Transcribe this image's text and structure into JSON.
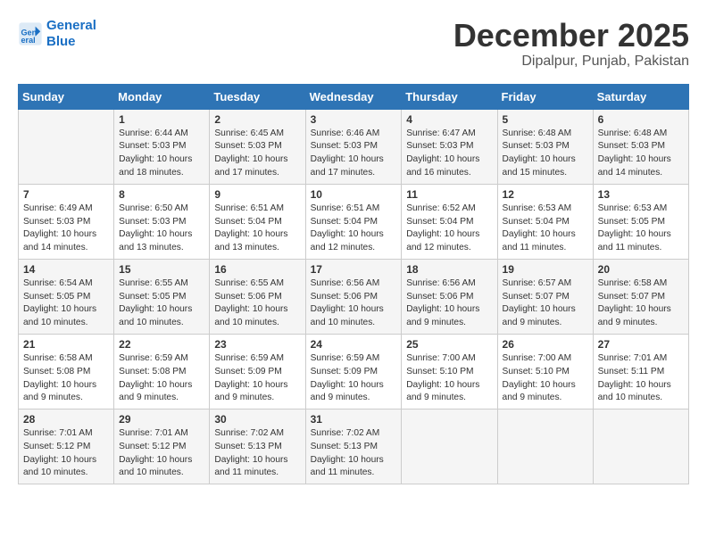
{
  "header": {
    "logo_line1": "General",
    "logo_line2": "Blue",
    "month": "December 2025",
    "location": "Dipalpur, Punjab, Pakistan"
  },
  "weekdays": [
    "Sunday",
    "Monday",
    "Tuesday",
    "Wednesday",
    "Thursday",
    "Friday",
    "Saturday"
  ],
  "weeks": [
    [
      {
        "day": "",
        "info": ""
      },
      {
        "day": "1",
        "info": "Sunrise: 6:44 AM\nSunset: 5:03 PM\nDaylight: 10 hours\nand 18 minutes."
      },
      {
        "day": "2",
        "info": "Sunrise: 6:45 AM\nSunset: 5:03 PM\nDaylight: 10 hours\nand 17 minutes."
      },
      {
        "day": "3",
        "info": "Sunrise: 6:46 AM\nSunset: 5:03 PM\nDaylight: 10 hours\nand 17 minutes."
      },
      {
        "day": "4",
        "info": "Sunrise: 6:47 AM\nSunset: 5:03 PM\nDaylight: 10 hours\nand 16 minutes."
      },
      {
        "day": "5",
        "info": "Sunrise: 6:48 AM\nSunset: 5:03 PM\nDaylight: 10 hours\nand 15 minutes."
      },
      {
        "day": "6",
        "info": "Sunrise: 6:48 AM\nSunset: 5:03 PM\nDaylight: 10 hours\nand 14 minutes."
      }
    ],
    [
      {
        "day": "7",
        "info": "Sunrise: 6:49 AM\nSunset: 5:03 PM\nDaylight: 10 hours\nand 14 minutes."
      },
      {
        "day": "8",
        "info": "Sunrise: 6:50 AM\nSunset: 5:03 PM\nDaylight: 10 hours\nand 13 minutes."
      },
      {
        "day": "9",
        "info": "Sunrise: 6:51 AM\nSunset: 5:04 PM\nDaylight: 10 hours\nand 13 minutes."
      },
      {
        "day": "10",
        "info": "Sunrise: 6:51 AM\nSunset: 5:04 PM\nDaylight: 10 hours\nand 12 minutes."
      },
      {
        "day": "11",
        "info": "Sunrise: 6:52 AM\nSunset: 5:04 PM\nDaylight: 10 hours\nand 12 minutes."
      },
      {
        "day": "12",
        "info": "Sunrise: 6:53 AM\nSunset: 5:04 PM\nDaylight: 10 hours\nand 11 minutes."
      },
      {
        "day": "13",
        "info": "Sunrise: 6:53 AM\nSunset: 5:05 PM\nDaylight: 10 hours\nand 11 minutes."
      }
    ],
    [
      {
        "day": "14",
        "info": "Sunrise: 6:54 AM\nSunset: 5:05 PM\nDaylight: 10 hours\nand 10 minutes."
      },
      {
        "day": "15",
        "info": "Sunrise: 6:55 AM\nSunset: 5:05 PM\nDaylight: 10 hours\nand 10 minutes."
      },
      {
        "day": "16",
        "info": "Sunrise: 6:55 AM\nSunset: 5:06 PM\nDaylight: 10 hours\nand 10 minutes."
      },
      {
        "day": "17",
        "info": "Sunrise: 6:56 AM\nSunset: 5:06 PM\nDaylight: 10 hours\nand 10 minutes."
      },
      {
        "day": "18",
        "info": "Sunrise: 6:56 AM\nSunset: 5:06 PM\nDaylight: 10 hours\nand 9 minutes."
      },
      {
        "day": "19",
        "info": "Sunrise: 6:57 AM\nSunset: 5:07 PM\nDaylight: 10 hours\nand 9 minutes."
      },
      {
        "day": "20",
        "info": "Sunrise: 6:58 AM\nSunset: 5:07 PM\nDaylight: 10 hours\nand 9 minutes."
      }
    ],
    [
      {
        "day": "21",
        "info": "Sunrise: 6:58 AM\nSunset: 5:08 PM\nDaylight: 10 hours\nand 9 minutes."
      },
      {
        "day": "22",
        "info": "Sunrise: 6:59 AM\nSunset: 5:08 PM\nDaylight: 10 hours\nand 9 minutes."
      },
      {
        "day": "23",
        "info": "Sunrise: 6:59 AM\nSunset: 5:09 PM\nDaylight: 10 hours\nand 9 minutes."
      },
      {
        "day": "24",
        "info": "Sunrise: 6:59 AM\nSunset: 5:09 PM\nDaylight: 10 hours\nand 9 minutes."
      },
      {
        "day": "25",
        "info": "Sunrise: 7:00 AM\nSunset: 5:10 PM\nDaylight: 10 hours\nand 9 minutes."
      },
      {
        "day": "26",
        "info": "Sunrise: 7:00 AM\nSunset: 5:10 PM\nDaylight: 10 hours\nand 9 minutes."
      },
      {
        "day": "27",
        "info": "Sunrise: 7:01 AM\nSunset: 5:11 PM\nDaylight: 10 hours\nand 10 minutes."
      }
    ],
    [
      {
        "day": "28",
        "info": "Sunrise: 7:01 AM\nSunset: 5:12 PM\nDaylight: 10 hours\nand 10 minutes."
      },
      {
        "day": "29",
        "info": "Sunrise: 7:01 AM\nSunset: 5:12 PM\nDaylight: 10 hours\nand 10 minutes."
      },
      {
        "day": "30",
        "info": "Sunrise: 7:02 AM\nSunset: 5:13 PM\nDaylight: 10 hours\nand 11 minutes."
      },
      {
        "day": "31",
        "info": "Sunrise: 7:02 AM\nSunset: 5:13 PM\nDaylight: 10 hours\nand 11 minutes."
      },
      {
        "day": "",
        "info": ""
      },
      {
        "day": "",
        "info": ""
      },
      {
        "day": "",
        "info": ""
      }
    ]
  ]
}
